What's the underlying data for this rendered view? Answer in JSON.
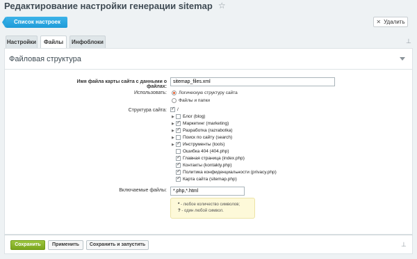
{
  "header": {
    "title": "Редактирование настройки генерации sitemap",
    "star_icon": "star-icon",
    "back_label": "Список настроек",
    "delete_label": "Удалить"
  },
  "tabs": [
    {
      "label": "Настройки"
    },
    {
      "label": "Файлы"
    },
    {
      "label": "Инфоблоки"
    }
  ],
  "section": {
    "title": "Файловая структура"
  },
  "form": {
    "filename_label": "Имя файла карты сайта с данными о файлах:",
    "filename_value": "sitemap_files.xml",
    "use_label": "Использовать:",
    "use_options": [
      "Логическую структуру сайта",
      "Файлы и папки"
    ],
    "structure_label": "Структура сайта:",
    "tree": [
      {
        "label": "/",
        "arrow": false,
        "checked": true
      },
      {
        "label": "Блог (blog)",
        "arrow": true,
        "checked": false
      },
      {
        "label": "Маркетинг (marketing)",
        "arrow": true,
        "checked": true
      },
      {
        "label": "Разработка (razrabotka)",
        "arrow": true,
        "checked": true
      },
      {
        "label": "Поиск по сайту (search)",
        "arrow": true,
        "checked": false
      },
      {
        "label": "Инструменты (tools)",
        "arrow": true,
        "checked": true
      },
      {
        "label": "Ошибка 404 (404.php)",
        "arrow": false,
        "checked": false
      },
      {
        "label": "Главная страница (index.php)",
        "arrow": false,
        "checked": true
      },
      {
        "label": "Контакты (kontakty.php)",
        "arrow": false,
        "checked": true
      },
      {
        "label": "Политика конфиденциальности (privacy.php)",
        "arrow": false,
        "checked": true
      },
      {
        "label": "Карта сайта (sitemap.php)",
        "arrow": false,
        "checked": true
      }
    ],
    "include_label": "Включаемые файлы:",
    "include_value": "*.php,*.html",
    "hint_line1_sym": "*",
    "hint_line1": " - любое количество символов;",
    "hint_line2_sym": "?",
    "hint_line2": " - один любой символ."
  },
  "footer": {
    "save": "Сохранить",
    "apply": "Применить",
    "save_run": "Сохранить и запустить"
  },
  "colors": {
    "accent": "#1e9bd8",
    "save": "#7aa51d",
    "radio_on": "#e65b2a"
  }
}
